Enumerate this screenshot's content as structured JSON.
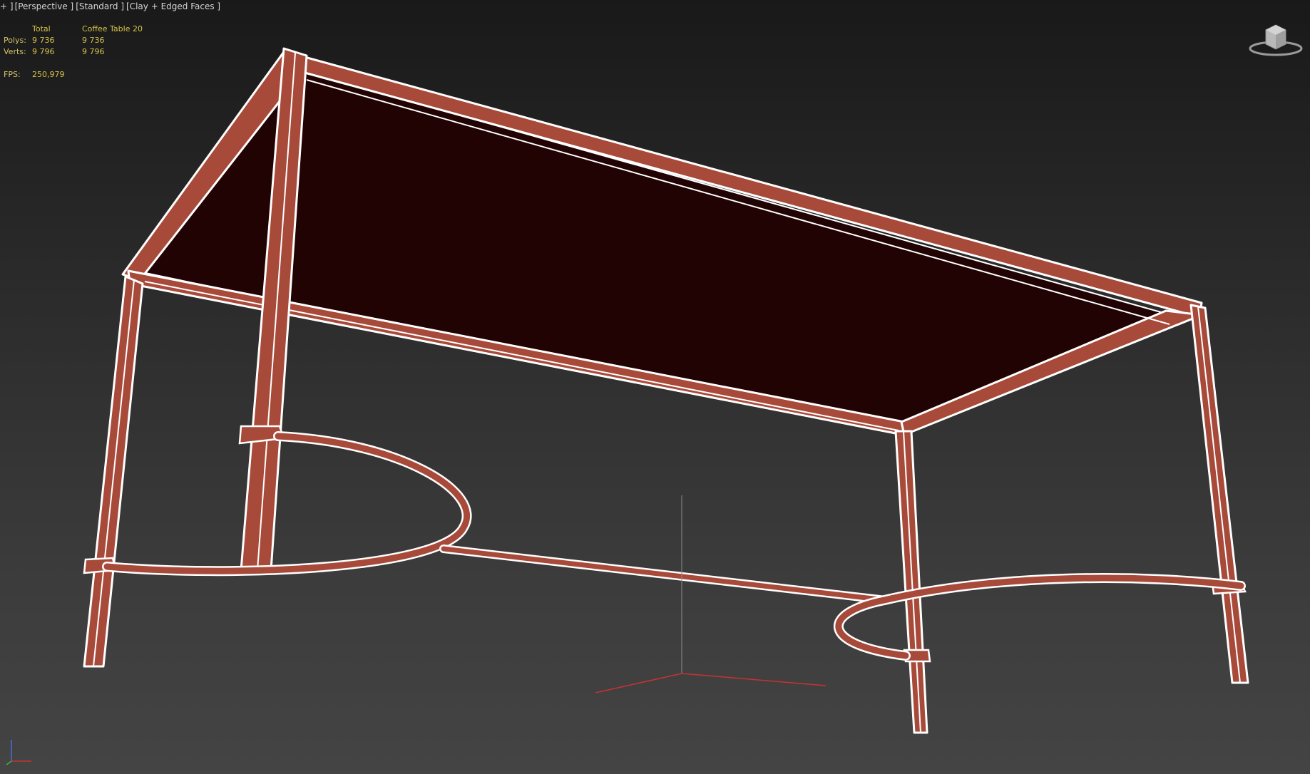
{
  "viewport": {
    "label_parts": [
      "+ ]",
      "[Perspective ]",
      "[Standard ]",
      "[Clay + Edged Faces ]"
    ]
  },
  "stats": {
    "header": [
      "",
      "Total",
      "Coffee Table 20"
    ],
    "rows": [
      {
        "label": "Polys:",
        "total": "9 736",
        "object": "9 736"
      },
      {
        "label": "Verts:",
        "total": "9 796",
        "object": "9 796"
      }
    ],
    "fps": {
      "label": "FPS:",
      "value": "250,979"
    }
  },
  "colors": {
    "wood": "#a84a3a",
    "edge": "#ffffff",
    "underside": "#230404",
    "stats_text": "#d7c24a",
    "axis_x": "#c83232",
    "axis_y": "#3fb43f",
    "axis_z": "#4a6fd6"
  },
  "icons": {
    "viewcube": "viewcube-icon",
    "axis": "axis-tripod-icon"
  }
}
